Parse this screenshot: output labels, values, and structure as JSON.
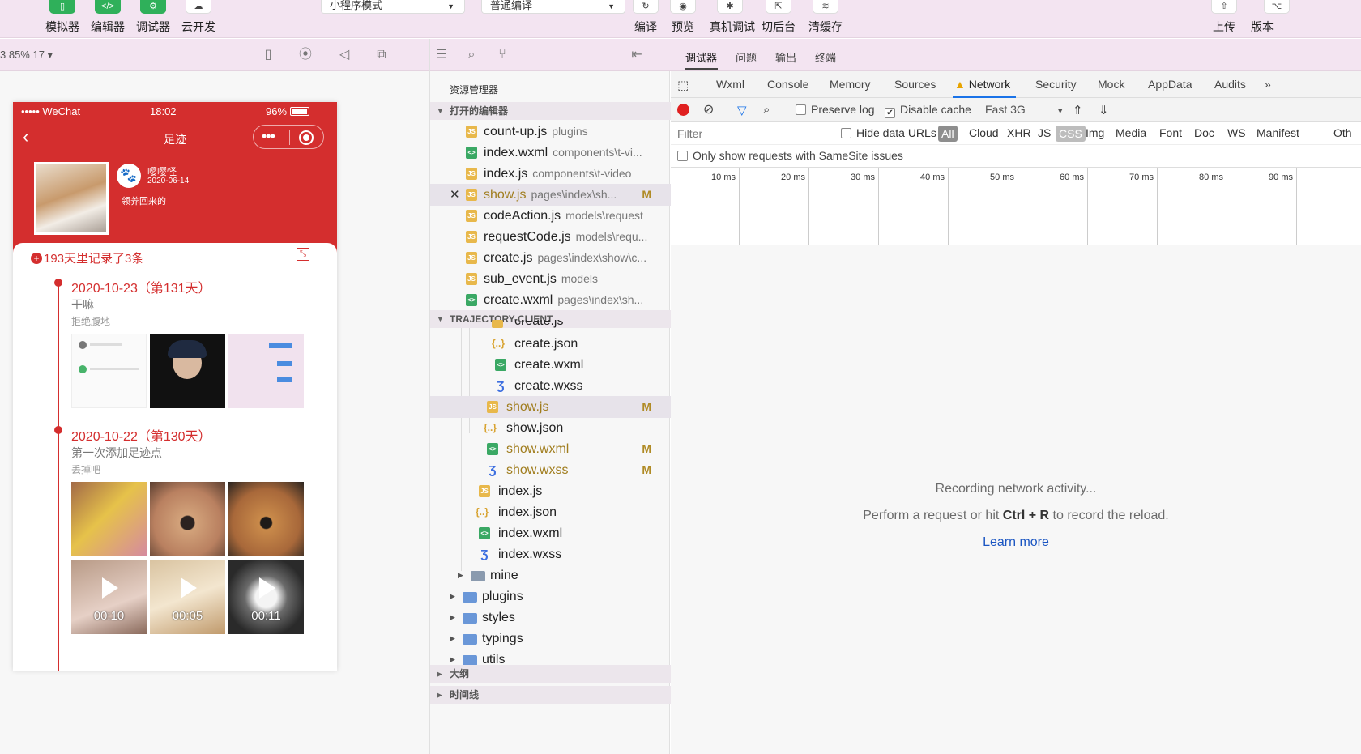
{
  "toolbar": {
    "simulator": "模拟器",
    "editor": "编辑器",
    "debugger": "调试器",
    "cloud": "云开发",
    "mode_select": "小程序模式",
    "compile_select": "普通编译",
    "compile": "编译",
    "preview": "预览",
    "real_debug": "真机调试",
    "background": "切后台",
    "clear_cache": "清缓存",
    "upload": "上传",
    "version": "版本"
  },
  "simulator": {
    "zoom": "3 85% 17 ▾",
    "status_carrier": "••••• WeChat",
    "status_time": "18:02",
    "status_battery": "96%",
    "nav_title": "足迹",
    "user_name": "嘤嘤怪",
    "user_date": "2020-06-14",
    "description": "领养回来的",
    "summary": "193天里记录了3条",
    "entries": [
      {
        "date": "2020-10-23（第131天）",
        "title": "干嘛",
        "sub": "拒绝腹地"
      },
      {
        "date": "2020-10-22（第130天）",
        "title": "第一次添加足迹点",
        "sub": "丢掉吧"
      }
    ],
    "videos": [
      "00:10",
      "00:05",
      "00:11"
    ]
  },
  "explorer": {
    "title": "资源管理器",
    "open_editors_label": "打开的编辑器",
    "open_editors": [
      {
        "name": "count-up.js",
        "path": "plugins"
      },
      {
        "name": "index.wxml",
        "path": "components\\t-vi..."
      },
      {
        "name": "index.js",
        "path": "components\\t-video"
      },
      {
        "name": "show.js",
        "path": "pages\\index\\sh...",
        "mod": "M"
      },
      {
        "name": "codeAction.js",
        "path": "models\\request"
      },
      {
        "name": "requestCode.js",
        "path": "models\\requ..."
      },
      {
        "name": "create.js",
        "path": "pages\\index\\show\\c..."
      },
      {
        "name": "sub_event.js",
        "path": "models"
      },
      {
        "name": "create.wxml",
        "path": "pages\\index\\sh..."
      }
    ],
    "project_label": "TRAJECTORY-CLIENT",
    "tree": [
      {
        "name": "create.js"
      },
      {
        "name": "create.json"
      },
      {
        "name": "create.wxml"
      },
      {
        "name": "create.wxss"
      },
      {
        "name": "show.js",
        "mod": "M"
      },
      {
        "name": "show.json"
      },
      {
        "name": "show.wxml",
        "mod": "M"
      },
      {
        "name": "show.wxss",
        "mod": "M"
      },
      {
        "name": "index.js"
      },
      {
        "name": "index.json"
      },
      {
        "name": "index.wxml"
      },
      {
        "name": "index.wxss"
      },
      {
        "name": "mine"
      },
      {
        "name": "plugins"
      },
      {
        "name": "styles"
      },
      {
        "name": "typings"
      },
      {
        "name": "utils"
      }
    ],
    "outline_label": "大纲",
    "timeline_label": "时间线"
  },
  "devtools": {
    "top_tabs": [
      "调试器",
      "问题",
      "输出",
      "终端"
    ],
    "tabs": [
      "Wxml",
      "Console",
      "Memory",
      "Sources",
      "Network",
      "Security",
      "Mock",
      "AppData",
      "Audits"
    ],
    "more": "»",
    "preserve_log": "Preserve log",
    "disable_cache": "Disable cache",
    "throttle": "Fast 3G",
    "filter_placeholder": "Filter",
    "hide_data_urls": "Hide data URLs",
    "filters": [
      "All",
      "Cloud",
      "XHR",
      "JS",
      "CSS",
      "Img",
      "Media",
      "Font",
      "Doc",
      "WS",
      "Manifest",
      "Oth"
    ],
    "samesite": "Only show requests with SameSite issues",
    "ticks": [
      "10 ms",
      "20 ms",
      "30 ms",
      "40 ms",
      "50 ms",
      "60 ms",
      "70 ms",
      "80 ms",
      "90 ms"
    ],
    "empty_line1": "Recording network activity...",
    "empty_line2_pre": "Perform a request or hit ",
    "empty_line2_key": "Ctrl + R",
    "empty_line2_post": " to record the reload.",
    "learn_more": "Learn more"
  }
}
